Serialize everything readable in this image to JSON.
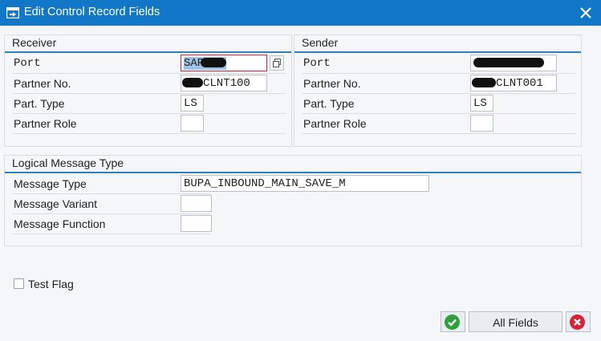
{
  "window": {
    "title": "Edit Control Record Fields",
    "title_bar_color": "#1377c8",
    "close_icon": "close-icon"
  },
  "receiver": {
    "title": "Receiver",
    "port_label": "Port",
    "port_value_visible": "SAP",
    "partner_no_label": "Partner No.",
    "partner_no_value_visible": "CLNT100",
    "part_type_label": "Part. Type",
    "part_type_value": "LS",
    "partner_role_label": "Partner Role",
    "partner_role_value": ""
  },
  "sender": {
    "title": "Sender",
    "port_label": "Port",
    "partner_no_label": "Partner No.",
    "partner_no_value_visible": "CLNT001",
    "part_type_label": "Part. Type",
    "part_type_value": "LS",
    "partner_role_label": "Partner Role",
    "partner_role_value": ""
  },
  "logical_message": {
    "title": "Logical Message Type",
    "message_type_label": "Message Type",
    "message_type_value": "BUPA_INBOUND_MAIN_SAVE_M",
    "message_variant_label": "Message Variant",
    "message_variant_value": "",
    "message_function_label": "Message Function",
    "message_function_value": ""
  },
  "test_flag": {
    "label": "Test Flag",
    "checked": false
  },
  "buttons": {
    "confirm_icon": "checkmark-icon",
    "confirm_color": "#2e9e3e",
    "all_fields_label": "All Fields",
    "cancel_icon": "cancel-icon",
    "cancel_color": "#d6223a"
  }
}
